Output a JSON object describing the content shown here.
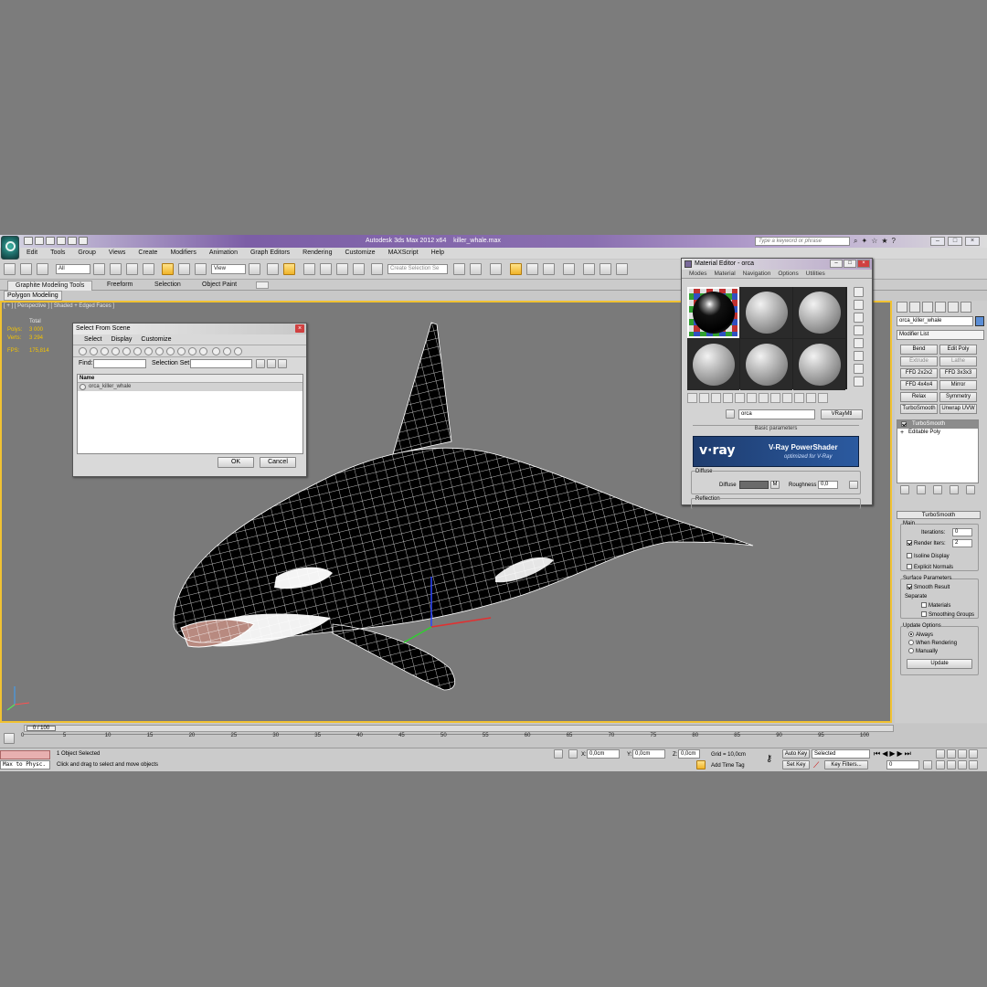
{
  "app": {
    "title": "Autodesk 3ds Max  2012 x64",
    "file": "killer_whale.max",
    "search_placeholder": "Type a keyword or phrase"
  },
  "menus": [
    "Edit",
    "Tools",
    "Group",
    "Views",
    "Create",
    "Modifiers",
    "Animation",
    "Graph Editors",
    "Rendering",
    "Customize",
    "MAXScript",
    "Help"
  ],
  "toolbar": {
    "filter": "All",
    "ref_coord": "View",
    "selection_set_placeholder": "Create Selection Se"
  },
  "ribbon": {
    "tabs": [
      "Graphite Modeling Tools",
      "Freeform",
      "Selection",
      "Object Paint"
    ],
    "panel": "Polygon Modeling"
  },
  "viewport": {
    "label": "[ + ] [ Perspective ] [ Shaded + Edged Faces ]",
    "stats_header": "Total",
    "stats": [
      {
        "k": "Polys:",
        "v": "3 000"
      },
      {
        "k": "Verts:",
        "v": "3 294"
      }
    ],
    "fps_label": "FPS:",
    "fps_value": "175,814"
  },
  "select_dialog": {
    "title": "Select From Scene",
    "menu": [
      "Select",
      "Display",
      "Customize"
    ],
    "find_label": "Find:",
    "selset_label": "Selection Set:",
    "column": "Name",
    "items": [
      "orca_killer_whale"
    ],
    "ok": "OK",
    "cancel": "Cancel"
  },
  "material_editor": {
    "title": "Material Editor - orca",
    "menu": [
      "Modes",
      "Material",
      "Navigation",
      "Options",
      "Utilities"
    ],
    "material_name": "orca",
    "material_type": "VRayMtl",
    "rollout_title": "Basic parameters",
    "vray_logo": "v·ray",
    "vray_title": "V-Ray PowerShader",
    "vray_sub": "optimized for V-Ray",
    "diffuse_group": "Diffuse",
    "diffuse_label": "Diffuse",
    "diffuse_map": "M",
    "roughness_label": "Roughness",
    "roughness_value": "0,0",
    "reflection_group": "Reflection"
  },
  "command_panel": {
    "object_name": "orca_killer_whale",
    "modifier_list": "Modifier List",
    "modifier_buttons": [
      "Bend",
      "Edit Poly",
      "Extrude",
      "Lathe",
      "FFD 2x2x2",
      "FFD 3x3x3",
      "FFD 4x4x4",
      "Mirror",
      "Relax",
      "Symmetry",
      "TurboSmooth",
      "Unwrap UVW"
    ],
    "stack": [
      "TurboSmooth",
      "Editable Poly"
    ],
    "turbosmooth": {
      "title": "TurboSmooth",
      "main": "Main",
      "iterations_label": "Iterations:",
      "iterations": "0",
      "render_iters_label": "Render Iters:",
      "render_iters": "2",
      "isoline": "Isoline Display",
      "explicit": "Explicit Normals",
      "surface_params": "Surface Parameters",
      "smooth_result": "Smooth Result",
      "separate": "Separate",
      "materials": "Materials",
      "smoothing_groups": "Smoothing Groups",
      "update_options": "Update Options",
      "always": "Always",
      "when_rendering": "When Rendering",
      "manually": "Manually",
      "update_btn": "Update"
    }
  },
  "timeline": {
    "frame": "0 / 100",
    "ticks": [
      "0",
      "5",
      "10",
      "15",
      "20",
      "25",
      "30",
      "35",
      "40",
      "45",
      "50",
      "55",
      "60",
      "65",
      "70",
      "75",
      "80",
      "85",
      "90",
      "95",
      "100"
    ]
  },
  "status": {
    "maxscript": "Max to Physc.",
    "selected": "1 Object Selected",
    "prompt": "Click and drag to select and move objects",
    "x_label": "X:",
    "x": "0,0cm",
    "y_label": "Y:",
    "y": "0,0cm",
    "z_label": "Z:",
    "z": "0,0cm",
    "grid": "Grid = 10,0cm",
    "add_time_tag": "Add Time Tag",
    "auto_key": "Auto Key",
    "selected_filter": "Selected",
    "set_key": "Set Key",
    "key_filters": "Key Filters...",
    "frame_value": "0"
  }
}
